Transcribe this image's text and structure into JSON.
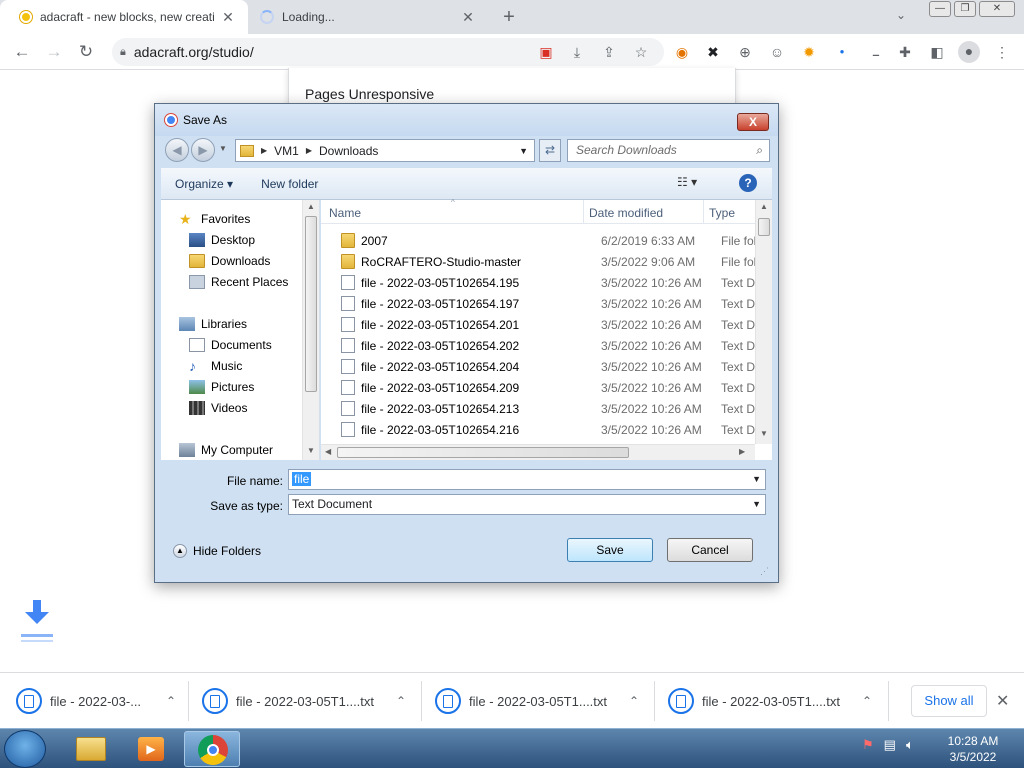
{
  "browser": {
    "tabs": [
      {
        "title": "adacraft - new blocks, new creati"
      },
      {
        "title": "Loading..."
      }
    ],
    "window_controls": {
      "minimize": "—",
      "maximize": "❐",
      "close": "✕"
    },
    "url": "adacraft.org/studio/"
  },
  "page": {
    "notice": "Pages Unresponsive"
  },
  "dialog": {
    "title": "Save As",
    "close_label": "X",
    "breadcrumb": [
      "VM1",
      "Downloads"
    ],
    "search_placeholder": "Search Downloads",
    "commands": {
      "organize": "Organize ▾",
      "new_folder": "New folder"
    },
    "help_label": "?",
    "nav": {
      "favorites": "Favorites",
      "desktop": "Desktop",
      "downloads": "Downloads",
      "recent": "Recent Places",
      "libraries": "Libraries",
      "documents": "Documents",
      "music": "Music",
      "pictures": "Pictures",
      "videos": "Videos",
      "computer": "My Computer"
    },
    "columns": {
      "name": "Name",
      "date": "Date modified",
      "type": "Type"
    },
    "files": [
      {
        "name": "2007",
        "date": "6/2/2019 6:33 AM",
        "type": "File fol",
        "kind": "folder"
      },
      {
        "name": "RoCRAFTERO-Studio-master",
        "date": "3/5/2022 9:06 AM",
        "type": "File fol",
        "kind": "folder"
      },
      {
        "name": "file - 2022-03-05T102654.195",
        "date": "3/5/2022 10:26 AM",
        "type": "Text D",
        "kind": "doc"
      },
      {
        "name": "file - 2022-03-05T102654.197",
        "date": "3/5/2022 10:26 AM",
        "type": "Text D",
        "kind": "doc"
      },
      {
        "name": "file - 2022-03-05T102654.201",
        "date": "3/5/2022 10:26 AM",
        "type": "Text D",
        "kind": "doc"
      },
      {
        "name": "file - 2022-03-05T102654.202",
        "date": "3/5/2022 10:26 AM",
        "type": "Text D",
        "kind": "doc"
      },
      {
        "name": "file - 2022-03-05T102654.204",
        "date": "3/5/2022 10:26 AM",
        "type": "Text D",
        "kind": "doc"
      },
      {
        "name": "file - 2022-03-05T102654.209",
        "date": "3/5/2022 10:26 AM",
        "type": "Text D",
        "kind": "doc"
      },
      {
        "name": "file - 2022-03-05T102654.213",
        "date": "3/5/2022 10:26 AM",
        "type": "Text D",
        "kind": "doc"
      },
      {
        "name": "file - 2022-03-05T102654.216",
        "date": "3/5/2022 10:26 AM",
        "type": "Text D",
        "kind": "doc"
      }
    ],
    "file_name_label": "File name:",
    "file_name_value": "file",
    "save_type_label": "Save as type:",
    "save_type_value": "Text Document",
    "hide_folders": "Hide Folders",
    "save_button": "Save",
    "cancel_button": "Cancel"
  },
  "downloads": {
    "items": [
      "file - 2022-03-...",
      "file - 2022-03-05T1....txt",
      "file - 2022-03-05T1....txt",
      "file - 2022-03-05T1....txt"
    ],
    "show_all": "Show all"
  },
  "taskbar": {
    "time": "10:28 AM",
    "date": "3/5/2022"
  },
  "colors": {
    "chrome_blue": "#1a73e8",
    "dialog_frame": "#cfe0f2",
    "taskbar": "#2d527c"
  }
}
